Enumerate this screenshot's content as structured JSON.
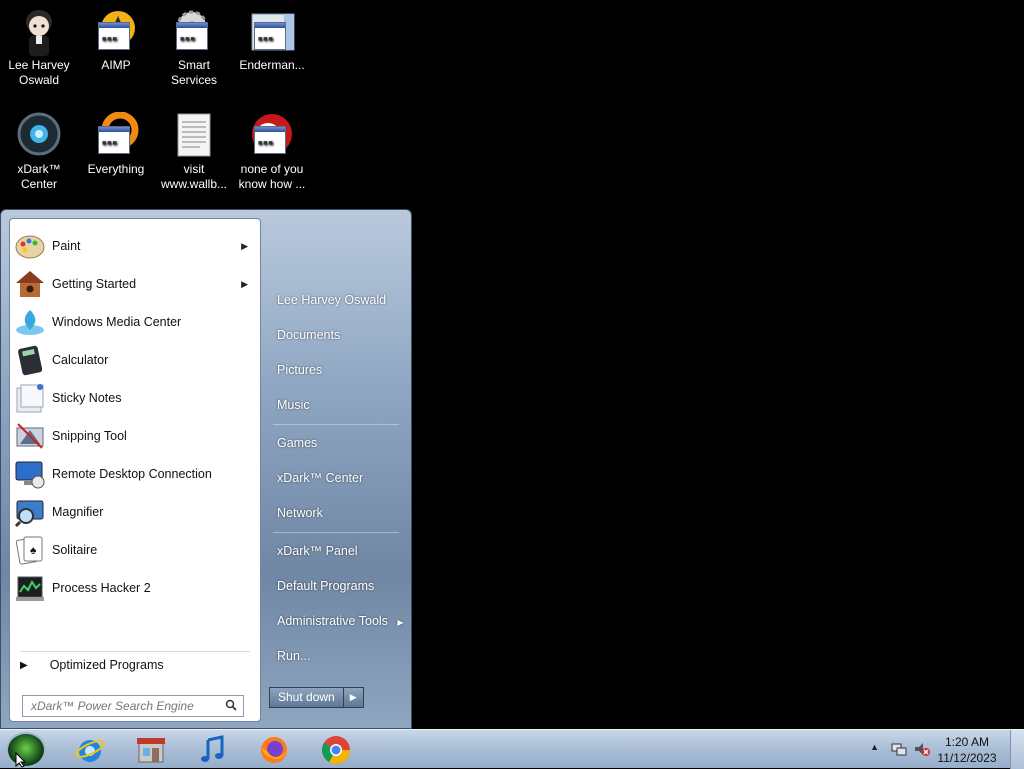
{
  "desktop": {
    "icons": [
      {
        "label": "Lee Harvey Oswald",
        "icon": "user-avatar-icon"
      },
      {
        "label": "AIMP",
        "icon": "aimp-icon"
      },
      {
        "label": "Smart Services",
        "icon": "gear-icon"
      },
      {
        "label": "Enderman...",
        "icon": "app-window-icon"
      },
      {
        "label": "xDark™ Center",
        "icon": "xdark-center-icon"
      },
      {
        "label": "Everything",
        "icon": "everything-icon"
      },
      {
        "label": "visit www.wallb...",
        "icon": "text-document-icon"
      },
      {
        "label": "none of you know how ...",
        "icon": "app-window-icon"
      }
    ]
  },
  "start_menu": {
    "programs": [
      {
        "label": "Paint",
        "icon": "paint-icon",
        "has_submenu": true
      },
      {
        "label": "Getting Started",
        "icon": "getting-started-icon",
        "has_submenu": true
      },
      {
        "label": "Windows Media Center",
        "icon": "media-center-icon",
        "has_submenu": false
      },
      {
        "label": "Calculator",
        "icon": "calculator-icon",
        "has_submenu": false
      },
      {
        "label": "Sticky Notes",
        "icon": "sticky-notes-icon",
        "has_submenu": false
      },
      {
        "label": "Snipping Tool",
        "icon": "snipping-tool-icon",
        "has_submenu": false
      },
      {
        "label": "Remote Desktop Connection",
        "icon": "remote-desktop-icon",
        "has_submenu": false
      },
      {
        "label": "Magnifier",
        "icon": "magnifier-icon",
        "has_submenu": false
      },
      {
        "label": "Solitaire",
        "icon": "solitaire-icon",
        "has_submenu": false
      },
      {
        "label": "Process Hacker 2",
        "icon": "process-hacker-icon",
        "has_submenu": false
      }
    ],
    "all_programs_label": "Optimized Programs",
    "search_placeholder": "xDark™ Power Search Engine",
    "right_items": [
      {
        "label": "Lee Harvey Oswald"
      },
      {
        "label": "Documents"
      },
      {
        "label": "Pictures"
      },
      {
        "label": "Music"
      },
      {
        "label": "Games"
      },
      {
        "label": "xDark™ Center"
      },
      {
        "label": "Network"
      },
      {
        "label": "xDark™ Panel"
      },
      {
        "label": "Default Programs"
      },
      {
        "label": "Administrative Tools",
        "has_submenu": true
      },
      {
        "label": "Run..."
      }
    ],
    "shutdown_label": "Shut down"
  },
  "taskbar": {
    "pinned": [
      {
        "name": "Internet Explorer",
        "icon": "internet-explorer-icon"
      },
      {
        "name": "Store",
        "icon": "store-icon"
      },
      {
        "name": "Music Player",
        "icon": "music-note-icon"
      },
      {
        "name": "Firefox",
        "icon": "firefox-icon"
      },
      {
        "name": "Chrome",
        "icon": "chrome-icon"
      }
    ],
    "clock": {
      "time": "1:20 AM",
      "date": "11/12/2023"
    }
  },
  "colors": {
    "accent": "#6f87a4",
    "taskbar": "#a9bdd6",
    "desktop": "#000000"
  }
}
